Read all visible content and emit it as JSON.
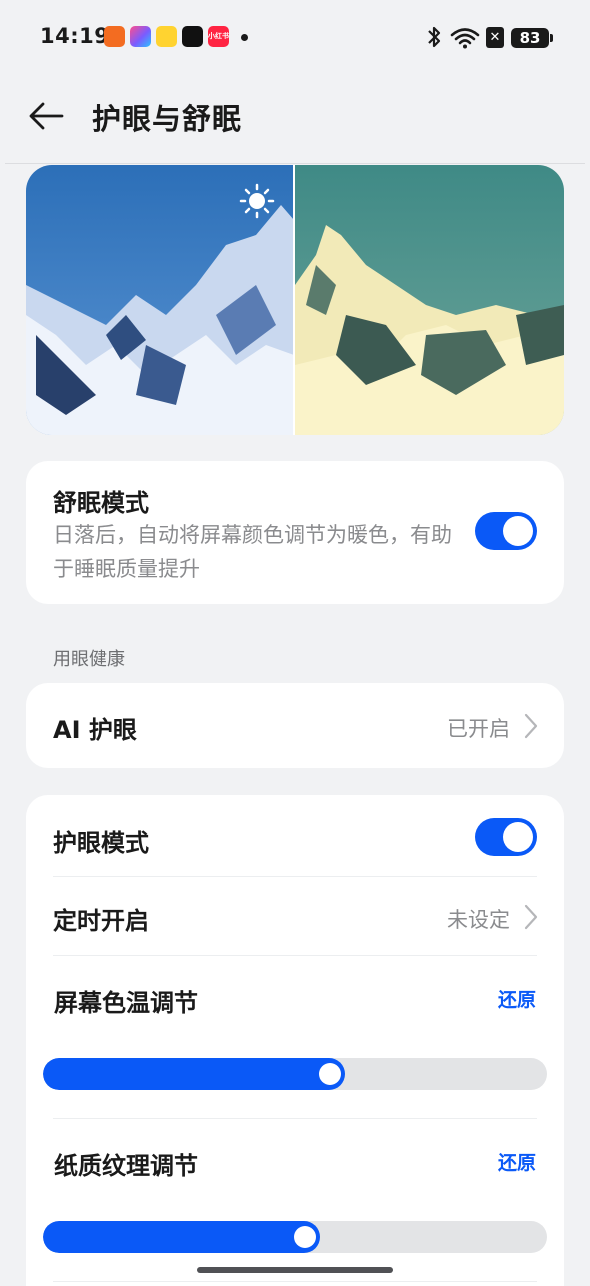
{
  "status_bar": {
    "time": "14:19",
    "battery": "83",
    "icons": [
      "taobao-app-icon",
      "app-icon",
      "weibo-icon",
      "douyin-icon",
      "xiaohongshu-icon",
      "notification-dot-icon",
      "bluetooth-icon",
      "wifi-icon",
      "no-sim-icon",
      "battery-icon"
    ],
    "xiaohongshu_label": "小红书"
  },
  "header": {
    "title": "护眼与舒眠"
  },
  "sleep_mode": {
    "title": "舒眠模式",
    "description": "日落后，自动将屏幕颜色调节为暖色，有助于睡眠质量提升",
    "enabled": true
  },
  "section_eye_health": {
    "label": "用眼健康"
  },
  "ai_eye": {
    "title": "AI 护眼",
    "value": "已开启"
  },
  "eye_comfort": {
    "title": "护眼模式",
    "enabled": true,
    "schedule_title": "定时开启",
    "schedule_value": "未设定",
    "color_temp_title": "屏幕色温调节",
    "color_temp_reset": "还原",
    "color_temp_level": 0.6,
    "paper_texture_title": "纸质纹理调节",
    "paper_texture_reset": "还原",
    "paper_texture_level": 0.55
  },
  "colors": {
    "accent": "#0a59f7",
    "background": "#f1f2f4",
    "card": "#ffffff"
  }
}
